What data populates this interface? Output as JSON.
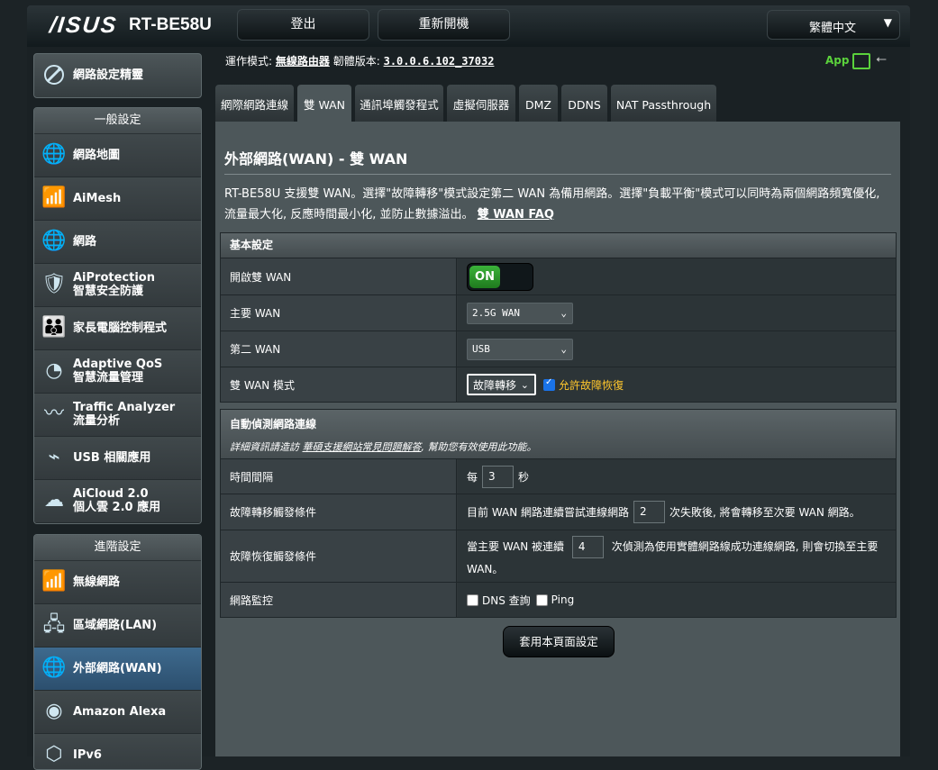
{
  "header": {
    "logo": "/ISUS",
    "model": "RT-BE58U",
    "logout": "登出",
    "reboot": "重新開機",
    "language": "繁體中文"
  },
  "info": {
    "mode_label": "運作模式:",
    "mode_value": "無線路由器",
    "fw_label": "韌體版本:",
    "fw_value": "3.0.0.6.102_37032",
    "app": "App"
  },
  "sidebar": {
    "qis": "網路設定精靈",
    "general_head": "一般設定",
    "general": [
      {
        "icon": "globe-map",
        "l1": "網路地圖",
        "l2": ""
      },
      {
        "icon": "aimesh",
        "l1": "AiMesh",
        "l2": ""
      },
      {
        "icon": "globe",
        "l1": "網路",
        "l2": ""
      },
      {
        "icon": "shield",
        "l1": "AiProtection",
        "l2": "智慧安全防護"
      },
      {
        "icon": "family",
        "l1": "家長電腦控制程式",
        "l2": ""
      },
      {
        "icon": "speedometer",
        "l1": "Adaptive QoS",
        "l2": "智慧流量管理"
      },
      {
        "icon": "analyzer",
        "l1": "Traffic Analyzer",
        "l2": "流量分析"
      },
      {
        "icon": "usb",
        "l1": "USB 相關應用",
        "l2": ""
      },
      {
        "icon": "cloud",
        "l1": "AiCloud 2.0",
        "l2": "個人雲 2.0 應用"
      }
    ],
    "advanced_head": "進階設定",
    "advanced": [
      {
        "icon": "wireless",
        "l1": "無線網路",
        "l2": ""
      },
      {
        "icon": "lan",
        "l1": "區域網路(LAN)",
        "l2": ""
      },
      {
        "icon": "wan",
        "l1": "外部網路(WAN)",
        "l2": ""
      },
      {
        "icon": "alexa",
        "l1": "Amazon Alexa",
        "l2": ""
      },
      {
        "icon": "ipv6",
        "l1": "IPv6",
        "l2": ""
      }
    ]
  },
  "tabs": [
    "網際網路連線",
    "雙 WAN",
    "通訊埠觸發程式",
    "虛擬伺服器",
    "DMZ",
    "DDNS",
    "NAT Passthrough"
  ],
  "page": {
    "title": "外部網路(WAN) - 雙 WAN",
    "desc": "RT-BE58U 支援雙 WAN。選擇\"故障轉移\"模式設定第二 WAN 為備用網路。選擇\"負載平衡\"模式可以同時為兩個網路頻寬優化, 流量最大化, 反應時間最小化, 並防止數據溢出。",
    "faq": "雙 WAN FAQ"
  },
  "basic": {
    "head": "基本設定",
    "enable_label": "開啟雙 WAN",
    "toggle": "ON",
    "primary_label": "主要 WAN",
    "primary_value": "2.5G WAN",
    "secondary_label": "第二 WAN",
    "secondary_value": "USB",
    "mode_label": "雙 WAN 模式",
    "mode_value": "故障轉移",
    "failback": "允許故障恢復"
  },
  "detect": {
    "head": "自動偵測網路連線",
    "sub_pre": "詳細資訊請造訪 ",
    "sub_link": "華碩支援網站常見問題解答",
    "sub_post": ", 幫助您有效使用此功能。",
    "interval_label": "時間間隔",
    "interval_pre": "每",
    "interval_val": "3",
    "interval_post": "秒",
    "failover_label": "故障轉移觸發條件",
    "failover_pre": "目前 WAN 網路連續嘗試連線網路",
    "failover_val": "2",
    "failover_post": "次失敗後, 將會轉移至次要 WAN 網路。",
    "failback_label": "故障恢復觸發條件",
    "failback_pre": "當主要 WAN 被連續",
    "failback_val": "4",
    "failback_post": "次偵測為使用實體網路線成功連線網路, 則會切換至主要",
    "failback_post2": "WAN。",
    "monitor_label": "網路監控",
    "dns": "DNS 查詢",
    "ping": "Ping"
  },
  "apply": "套用本頁面設定"
}
